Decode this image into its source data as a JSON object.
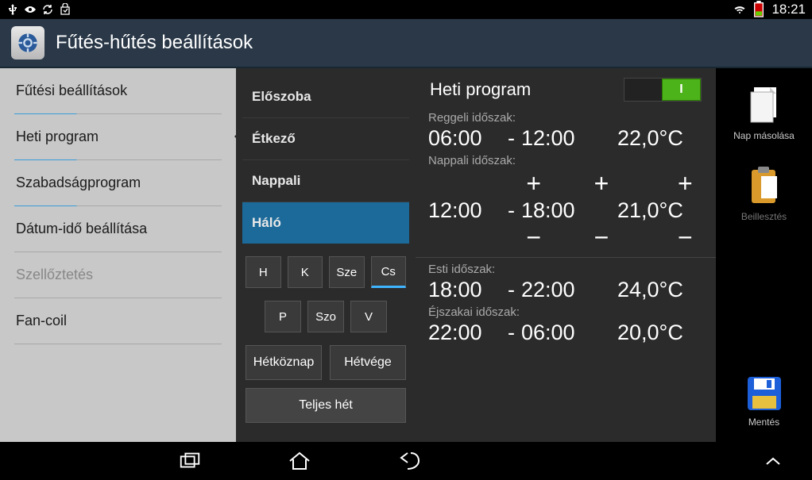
{
  "status": {
    "time": "18:21"
  },
  "title": "Fűtés-hűtés beállítások",
  "leftMenu": {
    "items": [
      {
        "label": "Fűtési beállítások",
        "disabled": false
      },
      {
        "label": "Heti program",
        "disabled": false,
        "active": true
      },
      {
        "label": "Szabadságprogram",
        "disabled": false
      },
      {
        "label": "Dátum-idő beállítása",
        "disabled": false
      },
      {
        "label": "Szellőztetés",
        "disabled": true
      },
      {
        "label": "Fan-coil",
        "disabled": false
      }
    ]
  },
  "rooms": {
    "items": [
      {
        "label": "Előszoba"
      },
      {
        "label": "Étkező"
      },
      {
        "label": "Nappali"
      },
      {
        "label": "Háló",
        "selected": true
      }
    ]
  },
  "days": {
    "row1": [
      {
        "l": "H"
      },
      {
        "l": "K"
      },
      {
        "l": "Sze"
      },
      {
        "l": "Cs",
        "sel": true
      }
    ],
    "row2": [
      {
        "l": "P"
      },
      {
        "l": "Szo"
      },
      {
        "l": "V"
      }
    ]
  },
  "groups": {
    "weekday": "Hétköznap",
    "weekend": "Hétvége",
    "fullweek": "Teljes hét"
  },
  "program": {
    "title": "Heti program",
    "toggle": "I",
    "periods": [
      {
        "name": "Reggeli időszak:",
        "from": "06:00",
        "to": "12:00",
        "temp": "22,0°C"
      },
      {
        "name": "Nappali időszak:",
        "from": "12:00",
        "to": "18:00",
        "temp": "21,0°C",
        "adjust": true
      },
      {
        "name": "Esti időszak:",
        "from": "18:00",
        "to": "22:00",
        "temp": "24,0°C"
      },
      {
        "name": "Éjszakai időszak:",
        "from": "22:00",
        "to": "06:00",
        "temp": "20,0°C"
      }
    ]
  },
  "actions": {
    "copy": "Nap másolása",
    "paste": "Beillesztés",
    "save": "Mentés"
  }
}
